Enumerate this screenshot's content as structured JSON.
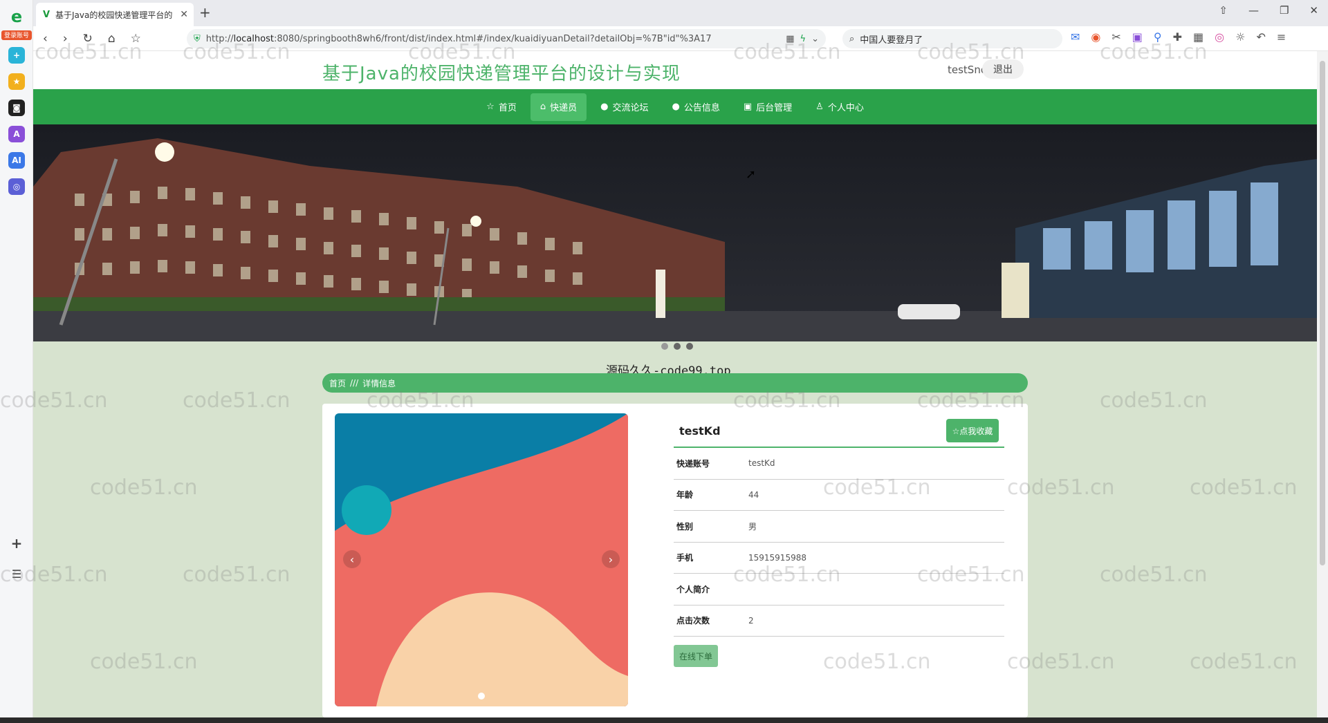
{
  "browser": {
    "tab_title": "基于Java的校园快递管理平台的",
    "url_prefix": "http://",
    "url_host": "localhost",
    "url_rest": ":8080/springbooth8wh6/front/dist/index.html#/index/kuaidiyuanDetail?detailObj=%7B\"id\"%3A17",
    "search_text": "中国人要登月了",
    "sidebar_login_badge": "登录账号"
  },
  "site": {
    "title": "基于Java的校园快递管理平台的设计与实现",
    "username": "testSno",
    "logout_label": "退出"
  },
  "menu": [
    {
      "label": "首页",
      "icon": "☆"
    },
    {
      "label": "快递员",
      "icon": "⌂"
    },
    {
      "label": "交流论坛",
      "icon": "●"
    },
    {
      "label": "公告信息",
      "icon": "●"
    },
    {
      "label": "后台管理",
      "icon": "▣"
    },
    {
      "label": "个人中心",
      "icon": "♙"
    }
  ],
  "overlay_text": "源码久久-code99.top",
  "breadcrumb": {
    "home": "首页",
    "sep": "///",
    "current": "详情信息"
  },
  "detail": {
    "name": "testKd",
    "favorite_label": "☆点我收藏",
    "fields": [
      {
        "label": "快递账号",
        "value": "testKd"
      },
      {
        "label": "年龄",
        "value": "44"
      },
      {
        "label": "性别",
        "value": "男"
      },
      {
        "label": "手机",
        "value": "15915915988"
      },
      {
        "label": "个人简介",
        "value": ""
      },
      {
        "label": "点击次数",
        "value": "2"
      }
    ],
    "order_label": "在线下单"
  },
  "watermark": "code51.cn",
  "colors": {
    "brand_green": "#2aa24a",
    "accent_green": "#4db36a",
    "page_bg": "#d7e3cf"
  }
}
